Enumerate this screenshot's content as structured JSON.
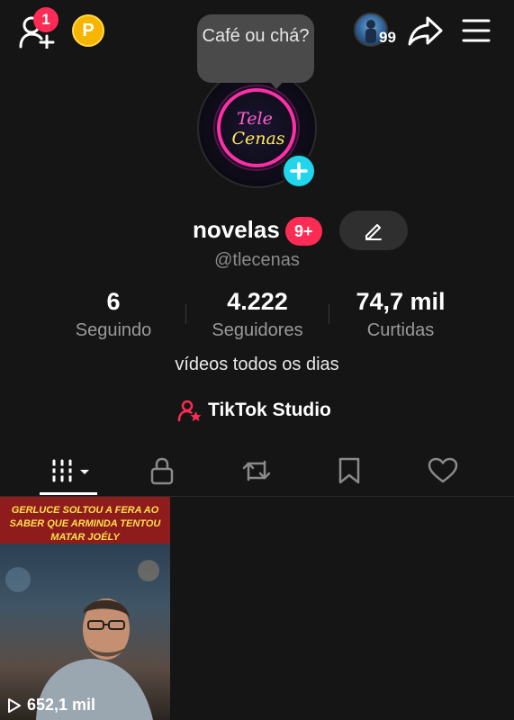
{
  "topbar": {
    "notification_count": "1",
    "coin_letter": "P",
    "story_count": "99"
  },
  "tooltip": {
    "text": "Café ou chá?"
  },
  "profile": {
    "avatar_logo_line1": "Tele",
    "avatar_logo_line2": "Cenas",
    "display_name": "novelas",
    "name_badge": "9+",
    "handle": "@tlecenas",
    "bio": "vídeos todos os dias",
    "studio_link": "TikTok Studio"
  },
  "stats": [
    {
      "value": "6",
      "label": "Seguindo"
    },
    {
      "value": "4.222",
      "label": "Seguidores"
    },
    {
      "value": "74,7 mil",
      "label": "Curtidas"
    }
  ],
  "tabs": [
    "videos-grid-icon",
    "lock-icon",
    "repost-icon",
    "bookmark-icon",
    "heart-icon"
  ],
  "videos": [
    {
      "caption": "GERLUCE SOLTOU A FERA AO SABER QUE ARMINDA TENTOU MATAR JOÉLY",
      "views": "652,1 mil"
    }
  ],
  "colors": {
    "background": "#151515",
    "accent_red": "#fe2c55",
    "accent_cyan": "#20d5ec",
    "coin": "#f7b500"
  }
}
